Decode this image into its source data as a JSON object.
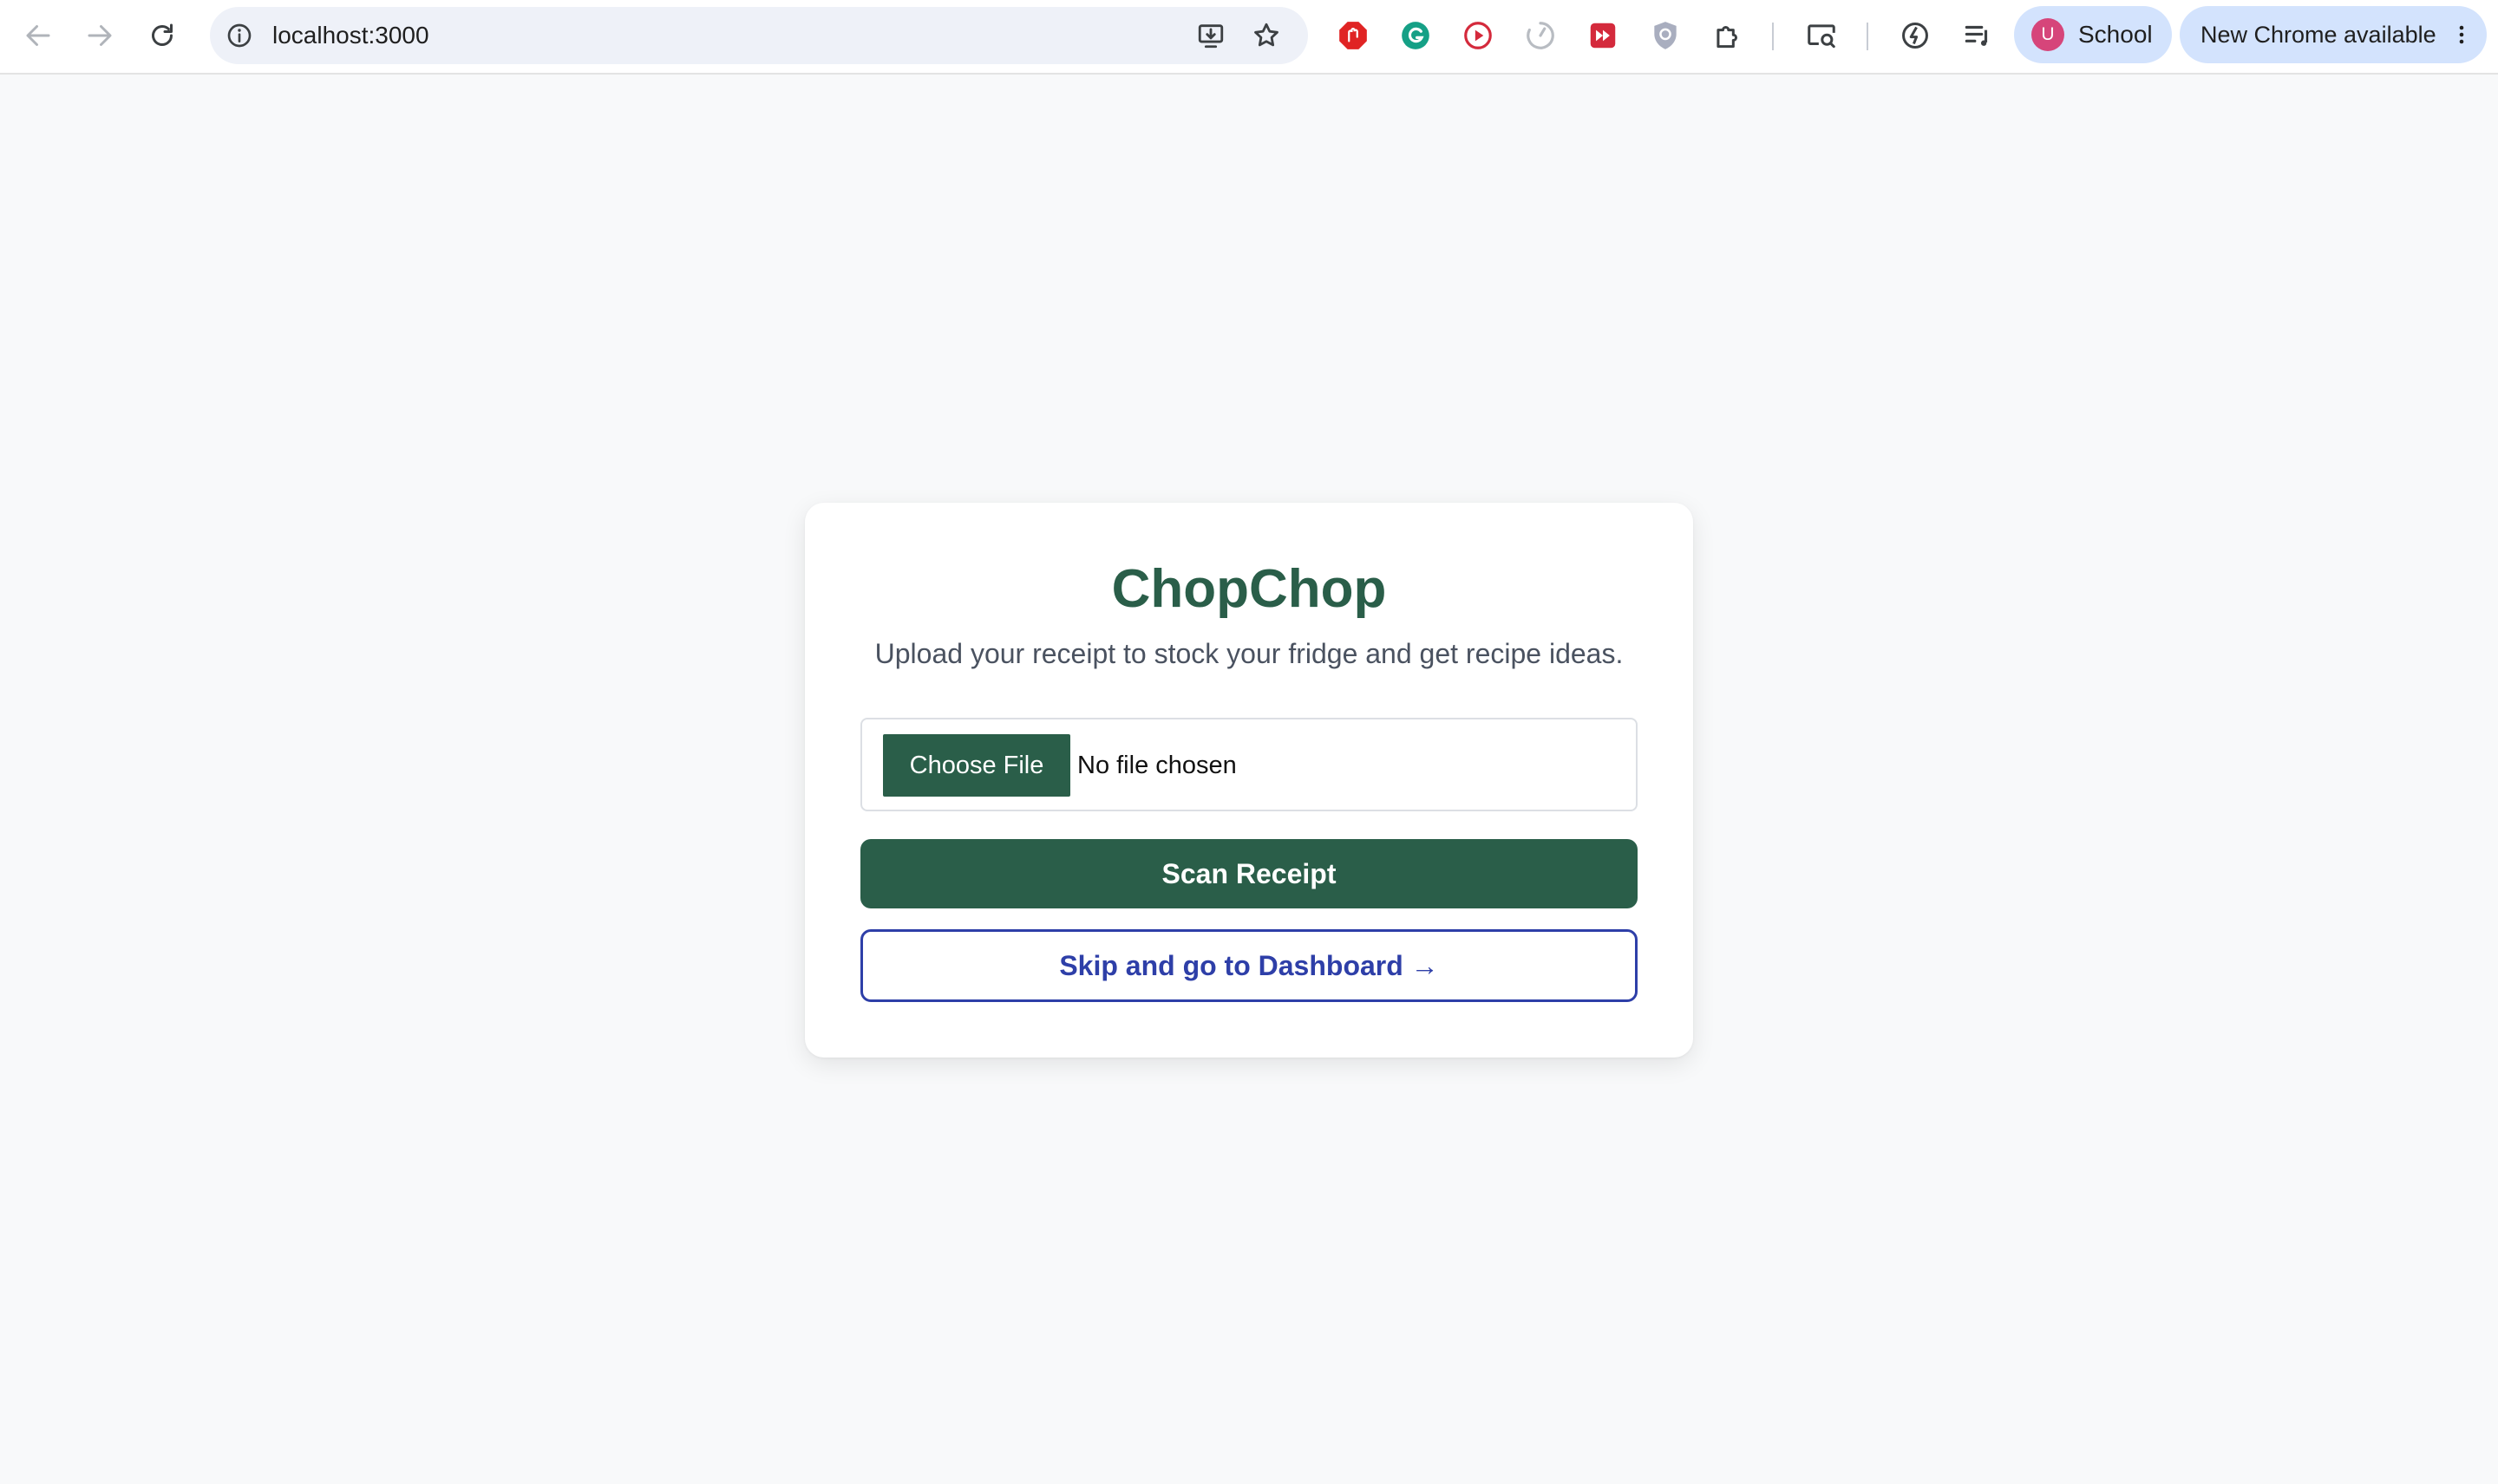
{
  "browser": {
    "url": "localhost:3000",
    "profile": {
      "initial": "U",
      "name": "School"
    },
    "update_label": "New Chrome available",
    "icons": [
      "back-icon",
      "forward-icon",
      "reload-icon",
      "site-info-icon",
      "install-app-icon",
      "bookmark-star-icon",
      "adblock-extension-icon",
      "grammarly-extension-icon",
      "media-extension-icon",
      "timer-extension-icon",
      "video-extension-icon",
      "shield-extension-icon",
      "extensions-puzzle-icon",
      "search-tab-icon",
      "performance-icon",
      "media-controls-icon",
      "kebab-menu-icon"
    ]
  },
  "app": {
    "title": "ChopChop",
    "subtitle": "Upload your receipt to stock your fridge and get recipe ideas.",
    "file_input": {
      "button_label": "Choose File",
      "status": "No file chosen"
    },
    "scan_label": "Scan Receipt",
    "skip_label": "Skip and go to Dashboard →"
  },
  "colors": {
    "brand_green": "#2a5e49",
    "link_blue": "#2e3fa8",
    "page_bg": "#f8f9fa",
    "chip_bg": "#d3e3fd"
  }
}
